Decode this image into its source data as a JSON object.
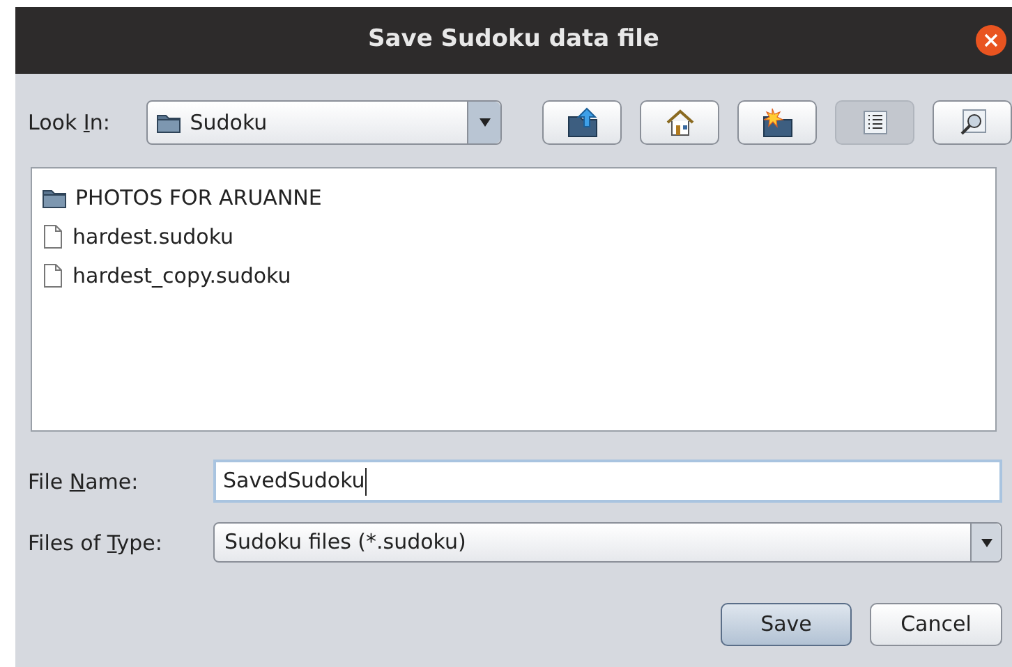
{
  "window": {
    "title": "Save Sudoku data file"
  },
  "look_in": {
    "label": {
      "before": "Look ",
      "mnemonic": "I",
      "after": "n:"
    },
    "value": "Sudoku"
  },
  "toolbar": [
    {
      "kind": "up",
      "selected": false
    },
    {
      "kind": "home",
      "selected": false
    },
    {
      "kind": "new-folder",
      "selected": false
    },
    {
      "kind": "list",
      "selected": true
    },
    {
      "kind": "details",
      "selected": false
    }
  ],
  "files": [
    {
      "kind": "folder",
      "name": "PHOTOS FOR ARUANNE"
    },
    {
      "kind": "file",
      "name": "hardest.sudoku"
    },
    {
      "kind": "file",
      "name": "hardest_copy.sudoku"
    }
  ],
  "file_name": {
    "label": {
      "before": "File ",
      "mnemonic": "N",
      "after": "ame:"
    },
    "value": "SavedSudoku"
  },
  "file_type": {
    "label": {
      "before": "Files of ",
      "mnemonic": "T",
      "after": "ype:"
    },
    "value": "Sudoku files (*.sudoku)"
  },
  "buttons": [
    {
      "label": "Save",
      "default": true
    },
    {
      "label": "Cancel",
      "default": false
    }
  ]
}
